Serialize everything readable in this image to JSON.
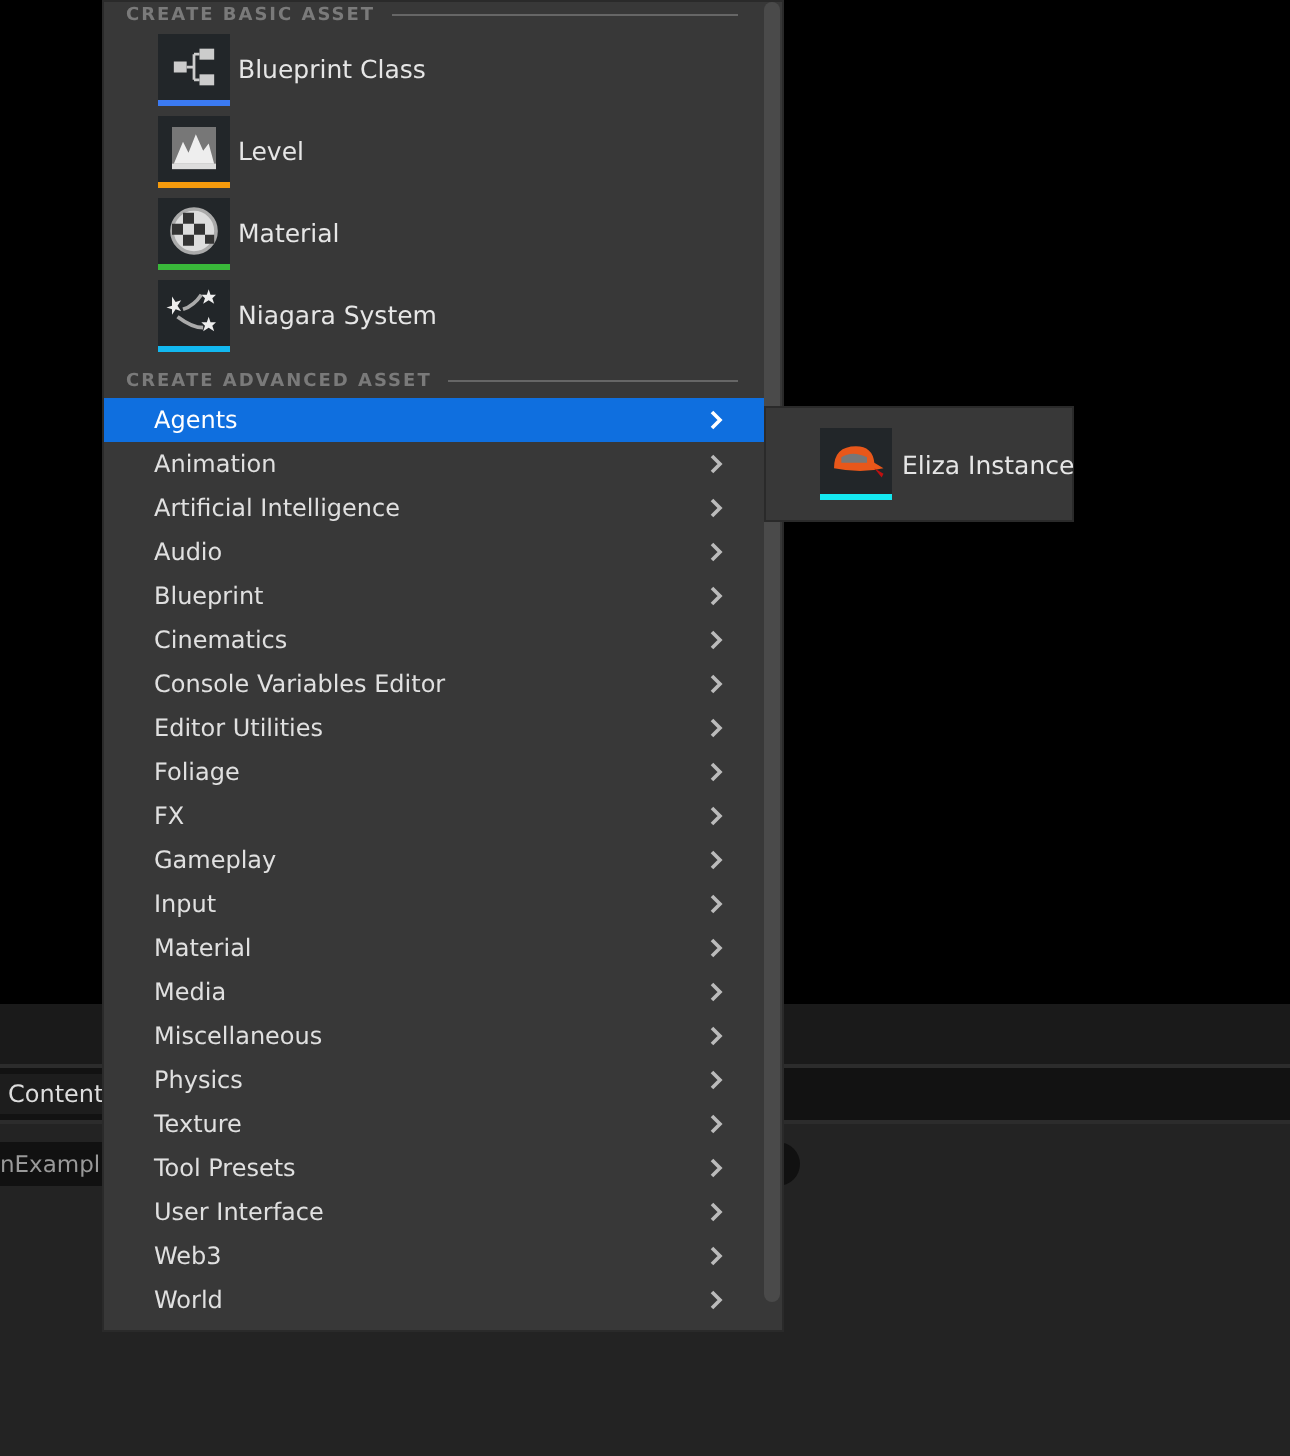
{
  "basic_section": {
    "heading": "CREATE BASIC ASSET",
    "items": [
      {
        "kind": "blueprint",
        "label": "Blueprint Class",
        "color": "#3b7af2"
      },
      {
        "kind": "level",
        "label": "Level",
        "color": "#f59a0c"
      },
      {
        "kind": "material",
        "label": "Material",
        "color": "#39b83a"
      },
      {
        "kind": "niagara",
        "label": "Niagara System",
        "color": "#12b8f0"
      }
    ]
  },
  "advanced_section": {
    "heading": "CREATE ADVANCED ASSET",
    "items": [
      {
        "label": "Agents",
        "selected": true
      },
      {
        "label": "Animation",
        "selected": false
      },
      {
        "label": "Artificial Intelligence",
        "selected": false
      },
      {
        "label": "Audio",
        "selected": false
      },
      {
        "label": "Blueprint",
        "selected": false
      },
      {
        "label": "Cinematics",
        "selected": false
      },
      {
        "label": "Console Variables Editor",
        "selected": false
      },
      {
        "label": "Editor Utilities",
        "selected": false
      },
      {
        "label": "Foliage",
        "selected": false
      },
      {
        "label": "FX",
        "selected": false
      },
      {
        "label": "Gameplay",
        "selected": false
      },
      {
        "label": "Input",
        "selected": false
      },
      {
        "label": "Material",
        "selected": false
      },
      {
        "label": "Media",
        "selected": false
      },
      {
        "label": "Miscellaneous",
        "selected": false
      },
      {
        "label": "Physics",
        "selected": false
      },
      {
        "label": "Texture",
        "selected": false
      },
      {
        "label": "Tool Presets",
        "selected": false
      },
      {
        "label": "User Interface",
        "selected": false
      },
      {
        "label": "Web3",
        "selected": false
      },
      {
        "label": "World",
        "selected": false
      }
    ]
  },
  "submenu": {
    "items": [
      {
        "kind": "cap",
        "label": "Eliza Instance",
        "color": "#14e8f0"
      }
    ]
  },
  "background": {
    "path_field": "Content",
    "search_field": "nExampl"
  }
}
